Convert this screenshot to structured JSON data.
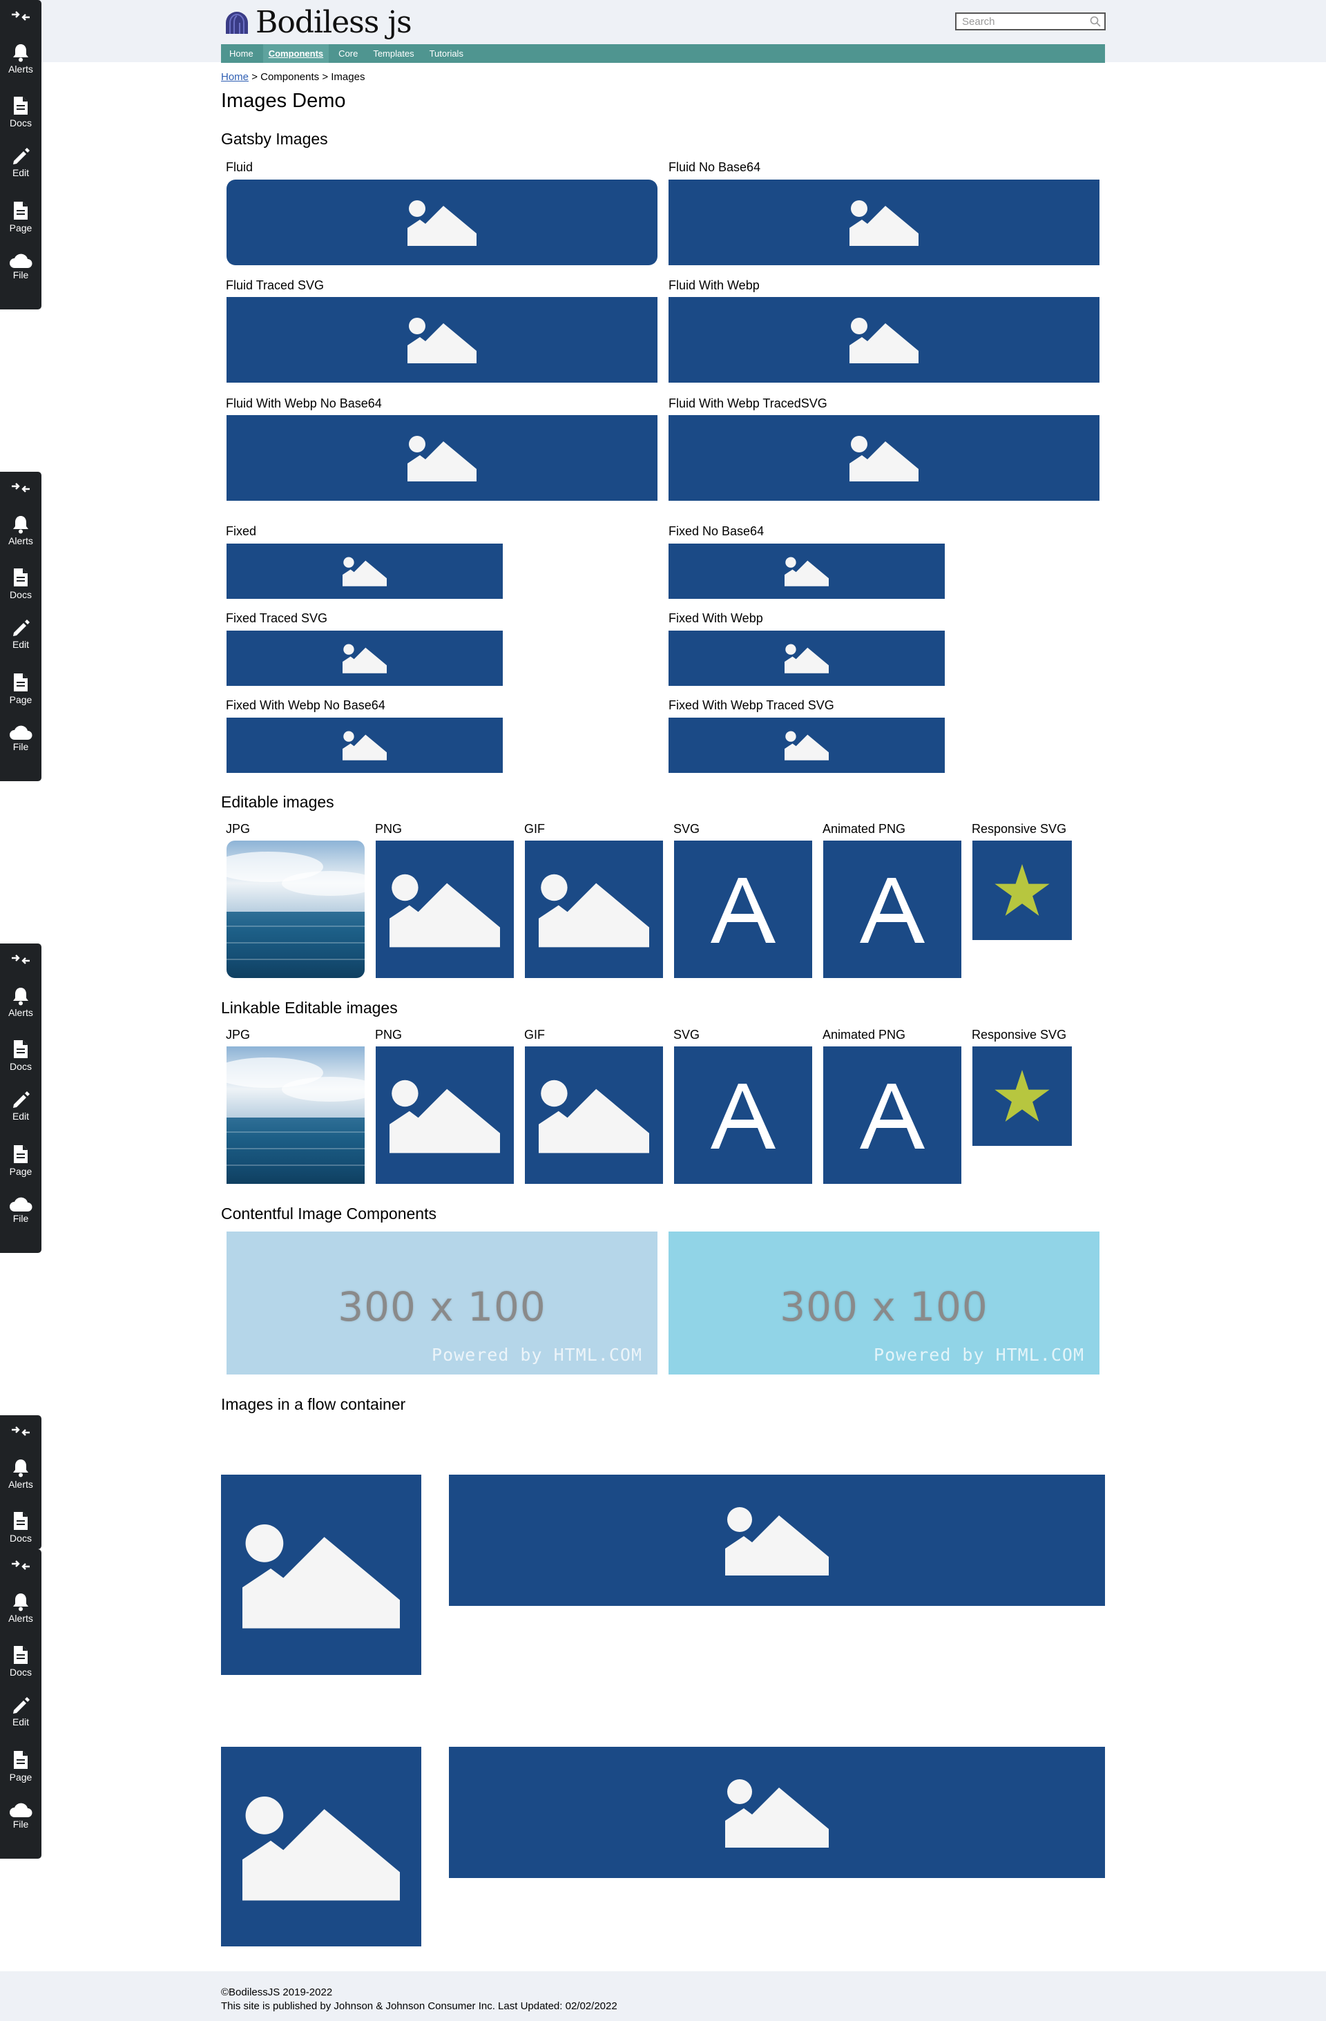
{
  "header": {
    "logo_text": "Bodiless js",
    "search_placeholder": "Search",
    "nav": [
      "Home",
      "Components",
      "Core",
      "Templates",
      "Tutorials"
    ]
  },
  "toolbar": {
    "items": [
      "Alerts",
      "Docs",
      "Edit",
      "Page",
      "File"
    ]
  },
  "breadcrumb": {
    "home": "Home",
    "rest": "> Components > Images"
  },
  "page_title": "Images Demo",
  "gatsby": {
    "title": "Gatsby Images",
    "labels": [
      "Fluid",
      "Fluid No Base64",
      "Fluid Traced SVG",
      "Fluid With Webp",
      "Fluid With Webp No Base64",
      "Fluid With Webp TracedSVG",
      "Fixed",
      "Fixed No Base64",
      "Fixed Traced SVG",
      "Fixed With Webp",
      "Fixed With Webp No Base64",
      "Fixed With Webp Traced SVG"
    ]
  },
  "editable": {
    "title": "Editable images",
    "labels": [
      "JPG",
      "PNG",
      "GIF",
      "SVG",
      "Animated PNG",
      "Responsive SVG"
    ]
  },
  "linkable": {
    "title": "Linkable Editable images",
    "labels": [
      "JPG",
      "PNG",
      "GIF",
      "SVG",
      "Animated PNG",
      "Responsive SVG"
    ]
  },
  "contentful": {
    "title": "Contentful Image Components",
    "size_text": "300 x 100",
    "credit_text": "Powered by HTML.COM"
  },
  "flow": {
    "title": "Images in a flow container"
  },
  "footer": {
    "copyright": "©BodilessJS 2019-2022",
    "published": "This site is published by Johnson & Johnson Consumer Inc. Last Updated: 02/02/2022"
  },
  "colors": {
    "placeholder_blue": "#1b4a86",
    "nav_teal": "#4f9590",
    "star_green": "#b7c63f",
    "contentful_bg_1": "#b5d6e9",
    "contentful_bg_2": "#91d4e7"
  }
}
